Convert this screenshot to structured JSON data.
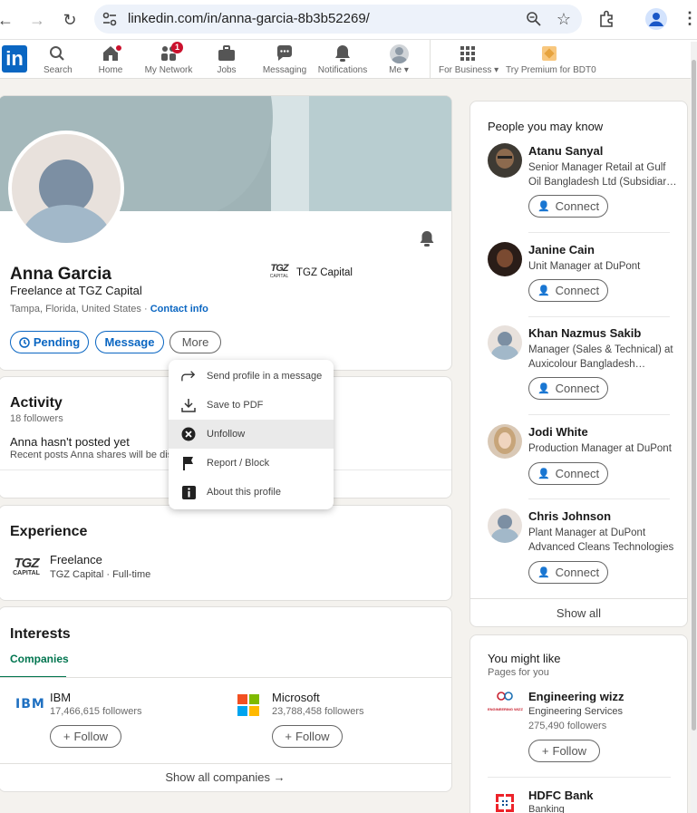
{
  "browser": {
    "url": "linkedin.com/in/anna-garcia-8b3b52269/"
  },
  "nav": {
    "logo": "in",
    "items": [
      {
        "label": "Search",
        "icon": "search-icon"
      },
      {
        "label": "Home",
        "icon": "home-icon"
      },
      {
        "label": "My Network",
        "icon": "network-icon",
        "badge": "1"
      },
      {
        "label": "Jobs",
        "icon": "briefcase-icon"
      },
      {
        "label": "Messaging",
        "icon": "message-icon"
      },
      {
        "label": "Notifications",
        "icon": "bell-icon"
      },
      {
        "label": "Me",
        "icon": "avatar"
      },
      {
        "label": "For Business",
        "icon": "grid-icon"
      },
      {
        "label": "Try Premium for BDT0",
        "icon": "premium-icon"
      }
    ]
  },
  "profile": {
    "name": "Anna Garcia",
    "headline": "Freelance at TGZ Capital",
    "location": "Tampa, Florida, United States ·",
    "contact_link": "Contact info",
    "company": "TGZ Capital",
    "company_logo": "TGZ",
    "company_logo_sub": "CAPITAL",
    "buttons": {
      "pending": "Pending",
      "message": "Message",
      "more": "More"
    }
  },
  "more_menu": {
    "items": [
      {
        "label": "Send profile in a message",
        "icon": "share-arrow-icon"
      },
      {
        "label": "Save to PDF",
        "icon": "download-icon"
      },
      {
        "label": "Unfollow",
        "icon": "close-circle-icon"
      },
      {
        "label": "Report / Block",
        "icon": "flag-icon"
      },
      {
        "label": "About this profile",
        "icon": "info-icon"
      }
    ]
  },
  "activity": {
    "title": "Activity",
    "followers": "18 followers",
    "empty_title": "Anna hasn't posted yet",
    "empty_sub": "Recent posts Anna shares will be dis"
  },
  "experience": {
    "title": "Experience",
    "role": "Freelance",
    "company": "TGZ Capital · Full-time",
    "logo": "TGZ",
    "logo_sub": "CAPITAL"
  },
  "interests": {
    "title": "Interests",
    "tab": "Companies",
    "items": [
      {
        "name": "IBM",
        "followers": "17,466,615 followers",
        "follow": "Follow",
        "logo": "IBM"
      },
      {
        "name": "Microsoft",
        "followers": "23,788,458 followers",
        "follow": "Follow"
      }
    ],
    "show_all": "Show all companies →"
  },
  "pymk": {
    "title": "People you may know",
    "connect_label": "Connect",
    "show_all": "Show all",
    "people": [
      {
        "name": "Atanu Sanyal",
        "title": "Senior Manager Retail at Gulf Oil Bangladesh Ltd (Subsidiar…"
      },
      {
        "name": "Janine Cain",
        "title": "Unit Manager at DuPont"
      },
      {
        "name": "Khan Nazmus Sakib",
        "title": "Manager (Sales & Technical) at Auxicolour Bangladesh…"
      },
      {
        "name": "Jodi White",
        "title": "Production Manager at DuPont"
      },
      {
        "name": "Chris Johnson",
        "title": "Plant Manager at DuPont Advanced Cleans Technologies"
      }
    ]
  },
  "you_might_like": {
    "title": "You might like",
    "subtitle": "Pages for you",
    "pages": [
      {
        "name": "Engineering wizz",
        "category": "Engineering Services",
        "followers": "275,490 followers",
        "follow": "Follow",
        "logo": "ENGINEERING WIZZ"
      },
      {
        "name": "HDFC Bank",
        "category": "Banking"
      }
    ]
  },
  "colors": {
    "brand": "#0a66c2",
    "badge": "#cb112d",
    "banner": "#a0b4b7"
  }
}
